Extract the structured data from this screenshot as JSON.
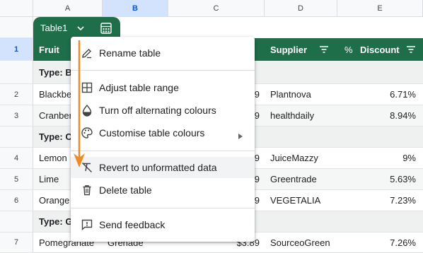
{
  "columns": [
    "A",
    "B",
    "C",
    "D",
    "E"
  ],
  "table": {
    "name": "Table1",
    "headers": {
      "fruit": "Fruit",
      "supplier": "Supplier",
      "discount": "Discount",
      "discount_icon": "%"
    }
  },
  "rows": [
    {
      "num": "2",
      "fruit": "Blackbe",
      "price": "9",
      "supplier": "Plantnova",
      "discount": "6.71%"
    },
    {
      "num": "3",
      "fruit": "Cranber",
      "price": "9",
      "supplier": "healthdaily",
      "discount": "8.94%"
    },
    {
      "num": "4",
      "fruit": "Lemon",
      "price": "9",
      "supplier": "JuiceMazzy",
      "discount": "9%"
    },
    {
      "num": "5",
      "fruit": "Lime",
      "price": "9",
      "supplier": "Greentrade",
      "discount": "5.63%"
    },
    {
      "num": "6",
      "fruit": "Orange",
      "price": "9",
      "supplier": "VEGETALIA",
      "discount": "7.23%"
    },
    {
      "num": "7",
      "fruit": "Pomegranate",
      "variety": "Grenade",
      "price": "$3.89",
      "supplier": "SourceoGreen",
      "discount": "7.26%"
    }
  ],
  "header_row_num": "1",
  "groups": [
    "Type: B",
    "Type: C",
    "Type: G"
  ],
  "menu": {
    "rename": "Rename table",
    "adjust": "Adjust table range",
    "alternating": "Turn off alternating colours",
    "customise": "Customise table colours",
    "revert": "Revert to unformatted data",
    "delete": "Delete table",
    "feedback": "Send feedback"
  },
  "colors": {
    "table_green": "#1e6e49",
    "arrow": "#f08a24",
    "select_blue": "#d3e3fd"
  },
  "icons": [
    "chevron-down-icon",
    "calculator-icon",
    "filter-icon",
    "pencil-icon",
    "table-range-icon",
    "drop-icon",
    "palette-icon",
    "submenu-arrow-icon",
    "clear-format-icon",
    "trash-icon",
    "feedback-icon"
  ]
}
